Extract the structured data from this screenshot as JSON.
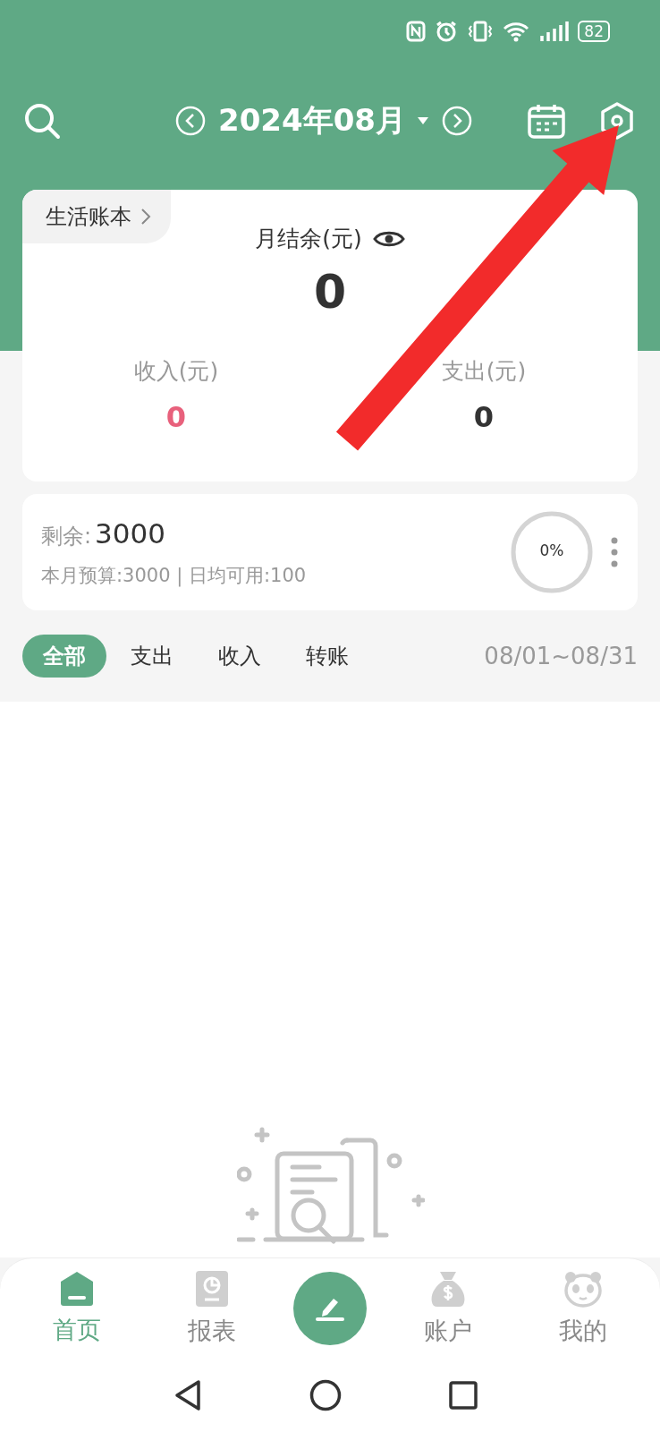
{
  "status_bar": {
    "battery": "82"
  },
  "header": {
    "month": "2024年08月"
  },
  "book": {
    "name": "生活账本"
  },
  "summary": {
    "title": "月结余(元)",
    "balance": "0",
    "income_label": "收入(元)",
    "income": "0",
    "expense_label": "支出(元)",
    "expense": "0"
  },
  "budget": {
    "label": "剩余:",
    "remaining": "3000",
    "detail": "本月预算:3000 | 日均可用:100",
    "percent": "0%"
  },
  "filters": [
    {
      "label": "全部",
      "selected": true
    },
    {
      "label": "支出",
      "selected": false
    },
    {
      "label": "收入",
      "selected": false
    },
    {
      "label": "转账",
      "selected": false
    }
  ],
  "date_range": "08/01~08/31",
  "nav": [
    {
      "kind": "home",
      "label": "首页",
      "selected": true
    },
    {
      "kind": "report",
      "label": "报表",
      "selected": false
    },
    {
      "kind": "add",
      "selected": false
    },
    {
      "kind": "account",
      "label": "账户",
      "selected": false
    },
    {
      "kind": "profile",
      "label": "我的",
      "selected": false
    }
  ]
}
